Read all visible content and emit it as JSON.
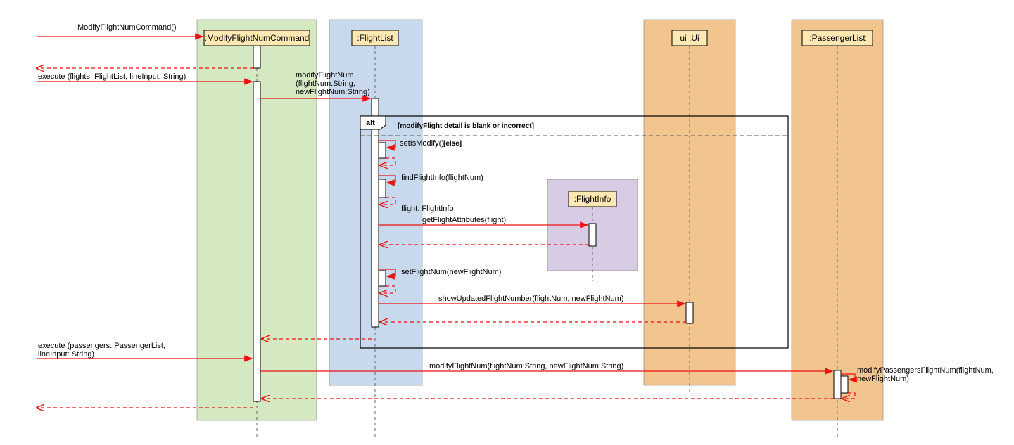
{
  "participants": {
    "cmd": ":ModifyFlightNumCommand",
    "flightlist": ":FlightList",
    "ui": "ui :Ui",
    "passengerlist": ":PassengerList",
    "flightinfo": ":FlightInfo"
  },
  "messages": {
    "create_cmd": "ModifyFlightNumCommand()",
    "execute1": "execute (flights: FlightList, lineInput: String)",
    "modifyFlightNum_call": "modifyFlightNum\n(flightNum:String,\nnewFlightNum:String)",
    "modifyFlightNum_line1": "modifyFlightNum",
    "modifyFlightNum_line2": "(flightNum:String,",
    "modifyFlightNum_line3": "newFlightNum:String)",
    "setIsModify": "setIsModify()",
    "else": "[else]",
    "findFlightInfo": "findFlightInfo(flightNum)",
    "flight_return": "flight: FlightInfo",
    "getFlightAttributes": "getFlightAttributes(flight)",
    "setFlightNum": "setFlightNum(newFlightNum)",
    "showUpdated": "showUpdatedFlightNumber(flightNum, newFlightNum)",
    "execute2_line1": "execute (passengers: PassengerList,",
    "execute2_line2": "lineInput: String)",
    "modifyFlightNum2": "modifyFlightNum(flightNum:String, newFlightNum:String)",
    "modifyPassengers_line1": "modifyPassengersFlightNum(flightNum,",
    "modifyPassengers_line2": "newFlightNum)"
  },
  "fragments": {
    "alt_label": "alt",
    "alt_guard1": "[modifyFlight detail is blank or incorrect]"
  }
}
